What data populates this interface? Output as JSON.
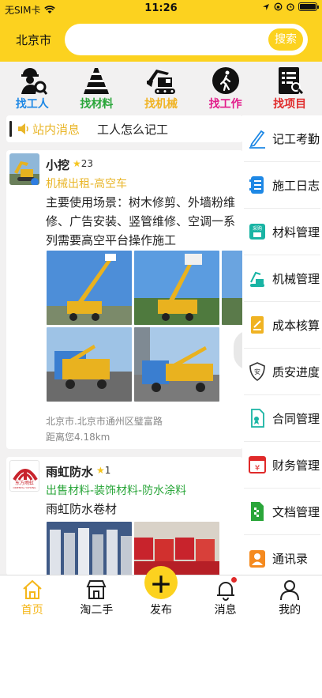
{
  "status": {
    "carrier": "无SIM卡",
    "time": "11:26"
  },
  "header": {
    "city": "北京市",
    "search_placeholder": "",
    "search_button": "搜索"
  },
  "categories": [
    {
      "label": "找工人",
      "color": "#1e88e5",
      "icon": "worker-search-icon"
    },
    {
      "label": "找材料",
      "color": "#2aa63a",
      "icon": "material-stack-icon"
    },
    {
      "label": "找机械",
      "color": "#f0b323",
      "icon": "excavator-icon"
    },
    {
      "label": "找工作",
      "color": "#e21b8a",
      "icon": "job-walker-icon"
    },
    {
      "label": "找项目",
      "color": "#e02a2a",
      "icon": "project-doc-icon"
    }
  ],
  "notice": {
    "label": "站内消息",
    "text": "工人怎么记工"
  },
  "posts": [
    {
      "name": "小挖",
      "stars": "23",
      "tag": "机械出租-高空车",
      "tag_color": "#e9b62a",
      "description": "主要使用场景：树木修剪、外墙粉维修、广告安装、竖管维修、空调一系列需要高空平台操作施工",
      "address": "北京市.北京市通州区璧富路",
      "distance": "距离您4.18km"
    },
    {
      "name": "雨虹防水",
      "stars": "1",
      "tag": "出售材料-装饰材料-防水涂料",
      "tag_color": "#2aa63a",
      "description": "雨虹防水卷材",
      "logo_text_cn": "东方雨虹",
      "logo_text_en": "ORIENTAL YUHONG"
    }
  ],
  "side_menu": [
    {
      "label": "记工考勤",
      "icon": "pen-icon",
      "color": "#1e88e5"
    },
    {
      "label": "施工日志",
      "icon": "log-book-icon",
      "color": "#1e88e5"
    },
    {
      "label": "材料管理",
      "icon": "purchase-icon",
      "color": "#19b4a4",
      "badge": "采购"
    },
    {
      "label": "机械管理",
      "icon": "crane-icon",
      "color": "#19b4a4"
    },
    {
      "label": "成本核算",
      "icon": "cost-doc-icon",
      "color": "#f0b323"
    },
    {
      "label": "质安进度",
      "icon": "safety-shield-icon",
      "color": "#333333",
      "badge": "安"
    },
    {
      "label": "合同管理",
      "icon": "contract-icon",
      "color": "#19b4a4"
    },
    {
      "label": "财务管理",
      "icon": "finance-icon",
      "color": "#e02a2a",
      "badge": "¥"
    },
    {
      "label": "文档管理",
      "icon": "document-icon",
      "color": "#2aa63a"
    },
    {
      "label": "通讯录",
      "icon": "contacts-icon",
      "color": "#f58a1f"
    }
  ],
  "tabbar": [
    {
      "label": "首页",
      "icon": "home-icon",
      "active": true
    },
    {
      "label": "淘二手",
      "icon": "shop-icon",
      "active": false
    },
    {
      "label": "发布",
      "icon": "plus-icon",
      "active": false
    },
    {
      "label": "消息",
      "icon": "bell-icon",
      "active": false
    },
    {
      "label": "我的",
      "icon": "user-icon",
      "active": false
    }
  ],
  "colors": {
    "brand_yellow": "#fcd21f",
    "active_tab": "#f5b71b",
    "star": "#f5c51f"
  }
}
